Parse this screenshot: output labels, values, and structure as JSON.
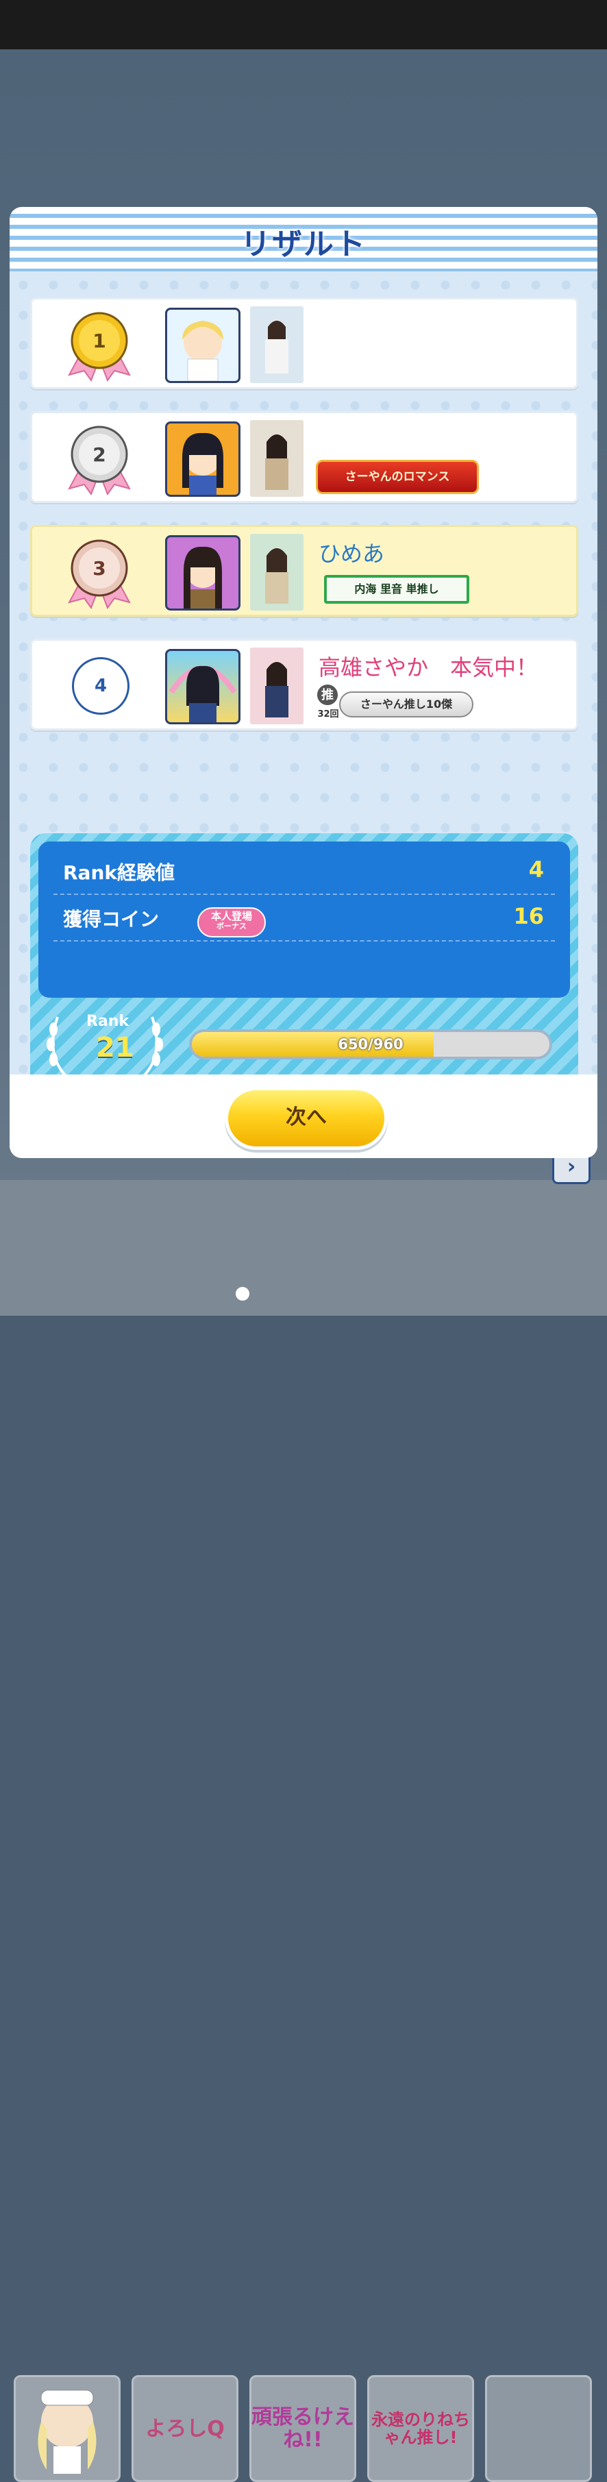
{
  "modal": {
    "title": "リザルト"
  },
  "results": [
    {
      "rank": 1,
      "name": "",
      "badge": ""
    },
    {
      "rank": 2,
      "name": "",
      "badge": "さーやんのロマンス"
    },
    {
      "rank": 3,
      "name": "ひめあ",
      "badge": "内海 里音 単推し",
      "is_self": true
    },
    {
      "rank": 4,
      "name": "高雄さやか　本気中！",
      "badge": "さーやん推し10傑",
      "oshi_icon": "推",
      "oshi_count": "32回"
    }
  ],
  "stats": {
    "rank_exp_label": "Rank経験値",
    "rank_exp_value": "4",
    "coin_label": "獲得コイン",
    "bonus_line1": "本人登場",
    "bonus_line2": "ボーナス",
    "coin_value": "16",
    "rank_label": "Rank",
    "rank_value": "21",
    "xp_current": 650,
    "xp_max": 960,
    "xp_text": "650/960"
  },
  "next_button": {
    "label": "次へ"
  },
  "stickers": [
    "よろしQ",
    "頑張るけえね!!",
    "永遠のりねちゃん推し!"
  ],
  "colors": {
    "title": "#1e4a9e",
    "self_row": "#fdf6c4",
    "stat_value": "#ffe84a",
    "button": "#ffd21f"
  }
}
